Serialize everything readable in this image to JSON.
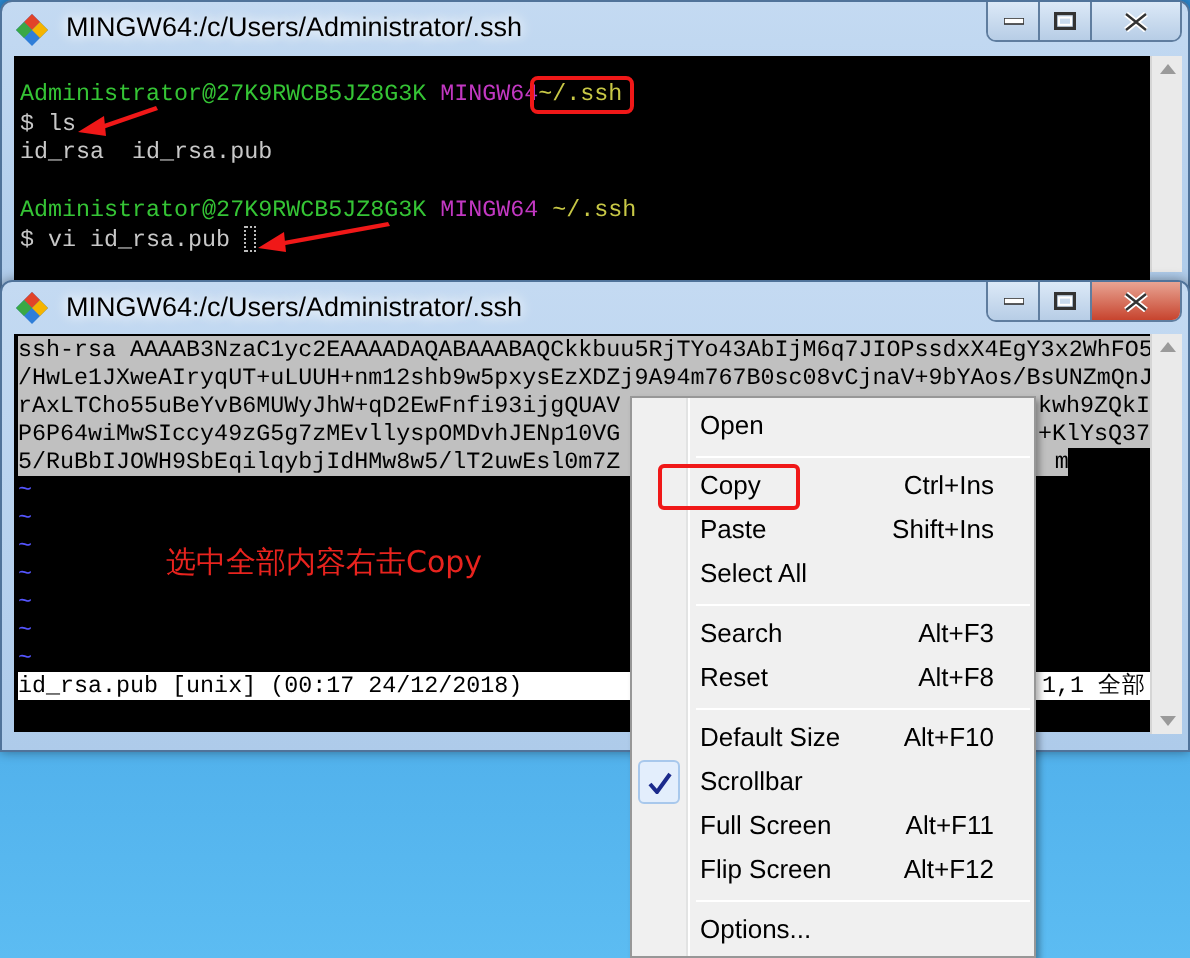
{
  "window_back": {
    "title": "MINGW64:/c/Users/Administrator/.ssh",
    "lines": [
      {
        "kind": "text",
        "segments": [
          {
            "text": "Administrator@27K9RWCB5JZ8G3K",
            "color": "#35c435"
          },
          {
            "text": "MINGW64",
            "color": "#c238c2"
          },
          {
            "text": "~/.ssh",
            "color": "#c8c846",
            "boxed": true
          }
        ]
      },
      {
        "kind": "text",
        "arrow": true,
        "segments": [
          {
            "text": "$ ls",
            "color": "#c8c8c8"
          }
        ]
      },
      {
        "kind": "text",
        "segments": [
          {
            "text": "id_rsa  id_rsa.pub",
            "color": "#c8c8c8"
          }
        ]
      },
      {
        "kind": "blank"
      },
      {
        "kind": "text",
        "segments": [
          {
            "text": "Administrator@27K9RWCB5JZ8G3K",
            "color": "#35c435"
          },
          {
            "text": "MINGW64",
            "color": "#c238c2"
          },
          {
            "text": "~/.ssh",
            "color": "#c8c846",
            "boxed": false
          }
        ]
      },
      {
        "kind": "text",
        "arrow": true,
        "cursor": true,
        "segments": [
          {
            "text": "$ vi id_rsa.pub",
            "color": "#c8c8c8"
          }
        ]
      }
    ]
  },
  "window_front": {
    "title": "MINGW64:/c/Users/Administrator/.ssh",
    "selected_lines": [
      {
        "left": "ssh-rsa AAAAB3NzaC1yc2EAAAADAQABAAABAQCkkbuu5RjTYo43AbIjM6q7JIOPssdxX4EgY3x2WhFO5"
      },
      {
        "left": "/HwLe1JXweAIryqUT+uLUUH+nm12shb9w5pxysEzXDZj9A94m767B0sc08vCjnaV+9bYAos/BsUNZmQnJ"
      },
      {
        "left": "rAxLTCho55uBeYvB6MUWyJhW+qD2EwFnfi93ijgQUAV",
        "right": "kwh9ZQkI"
      },
      {
        "left": "P6P64wiMwSIccy49zG5g7zMEvllyspOMDvhJENp10VG",
        "right": "+KlYsQ37"
      },
      {
        "left": "5/RuBbIJOWH9SbEqilqybjIdHMw8w5/lT2uwEsl0m7Z",
        "right": "m"
      }
    ],
    "empty_lines": [
      "~",
      "~",
      "~",
      "~",
      "~",
      "~",
      "~"
    ],
    "note": "选中全部内容右击Copy",
    "status_left": "id_rsa.pub [unix] (00:17 24/12/2018)",
    "status_right": "1,1 全部"
  },
  "context_menu": {
    "items": [
      {
        "kind": "item",
        "label": "Open",
        "checked": false,
        "circled": false
      },
      {
        "kind": "separator"
      },
      {
        "kind": "item",
        "label": "Copy",
        "shortcut": "Ctrl+Ins",
        "checked": false,
        "circled": true
      },
      {
        "kind": "item",
        "label": "Paste",
        "shortcut": "Shift+Ins",
        "checked": false,
        "circled": false
      },
      {
        "kind": "item",
        "label": "Select All",
        "checked": false,
        "circled": false
      },
      {
        "kind": "separator"
      },
      {
        "kind": "item",
        "label": "Search",
        "shortcut": "Alt+F3",
        "checked": false,
        "circled": false
      },
      {
        "kind": "item",
        "label": "Reset",
        "shortcut": "Alt+F8",
        "checked": false,
        "circled": false
      },
      {
        "kind": "separator"
      },
      {
        "kind": "item",
        "label": "Default Size",
        "shortcut": "Alt+F10",
        "checked": false,
        "circled": false
      },
      {
        "kind": "item",
        "label": "Scrollbar",
        "checked": true,
        "circled": false
      },
      {
        "kind": "item",
        "label": "Full Screen",
        "shortcut": "Alt+F11",
        "checked": false,
        "circled": false
      },
      {
        "kind": "item",
        "label": "Flip Screen",
        "shortcut": "Alt+F12",
        "checked": false,
        "circled": false
      },
      {
        "kind": "separator"
      },
      {
        "kind": "item",
        "label": "Options...",
        "checked": false,
        "circled": false
      }
    ]
  }
}
